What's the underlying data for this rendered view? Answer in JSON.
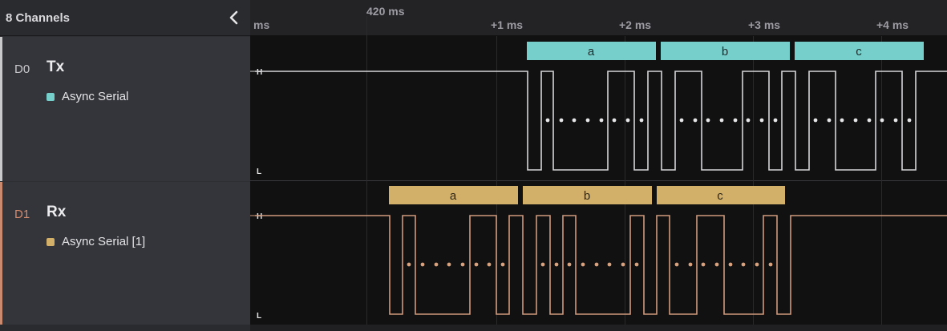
{
  "sidebar": {
    "title": "8 Channels",
    "channels": [
      {
        "id": "D0",
        "name": "Tx",
        "analyzer": "Async Serial",
        "color": "#76cfcb",
        "id_color": "#c8c8cc"
      },
      {
        "id": "D1",
        "name": "Rx",
        "analyzer": "Async Serial [1]",
        "color": "#d3b06a",
        "id_color": "#d38a6c"
      }
    ]
  },
  "ruler": {
    "anchor": "420 ms",
    "unit": "ms",
    "ticks": [
      "+1 ms",
      "+2 ms",
      "+3 ms",
      "+4 ms"
    ]
  },
  "tracks": [
    {
      "signal_color": "#d6d6d8",
      "high_label": "H",
      "low_label": "L",
      "frames": [
        {
          "label": "a",
          "color": "#76cfcb"
        },
        {
          "label": "b",
          "color": "#76cfcb"
        },
        {
          "label": "c",
          "color": "#76cfcb"
        }
      ]
    },
    {
      "signal_color": "#d09a7c",
      "high_label": "H",
      "low_label": "L",
      "frames": [
        {
          "label": "a",
          "color": "#d3b06a"
        },
        {
          "label": "b",
          "color": "#d3b06a"
        },
        {
          "label": "c",
          "color": "#d3b06a"
        }
      ]
    }
  ]
}
